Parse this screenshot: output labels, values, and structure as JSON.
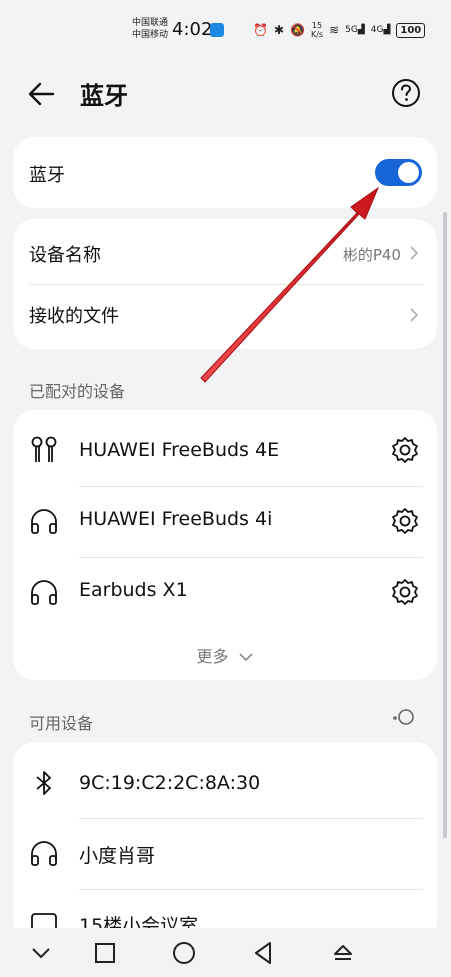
{
  "status_bar": {
    "carrier_1": "中国联通",
    "carrier_2": "中国移动",
    "time": "4:02",
    "net_speed_value": "15",
    "net_speed_unit": "K/s",
    "signal_1": "5G",
    "signal_2": "4G",
    "battery": "100"
  },
  "header": {
    "title": "蓝牙",
    "back_icon": "arrow-left-icon",
    "help_icon": "question-circle-icon"
  },
  "bluetooth_toggle": {
    "label": "蓝牙",
    "enabled": true,
    "accent_color": "#1565d8"
  },
  "settings": {
    "device_name_label": "设备名称",
    "device_name_value": "彬的P40",
    "received_files_label": "接收的文件"
  },
  "paired_section": {
    "label": "已配对的设备",
    "devices": [
      {
        "name": "HUAWEI FreeBuds 4E",
        "icon": "earbuds-icon"
      },
      {
        "name": "HUAWEI FreeBuds 4i",
        "icon": "headphones-icon"
      },
      {
        "name": "Earbuds X1",
        "icon": "headphones-icon"
      }
    ],
    "more_label": "更多"
  },
  "available_section": {
    "label": "可用设备",
    "devices": [
      {
        "name": "9C:19:C2:2C:8A:30",
        "icon": "bluetooth-icon"
      },
      {
        "name": "小度肖哥",
        "icon": "headphones-icon"
      },
      {
        "name": "15楼小会议室",
        "icon": "display-icon"
      }
    ]
  },
  "annotation": {
    "arrow_color": "#e8262b"
  },
  "nav_bar": {
    "icons": [
      "chevron-down-icon",
      "square-icon",
      "circle-icon",
      "triangle-back-icon",
      "eject-icon"
    ]
  }
}
